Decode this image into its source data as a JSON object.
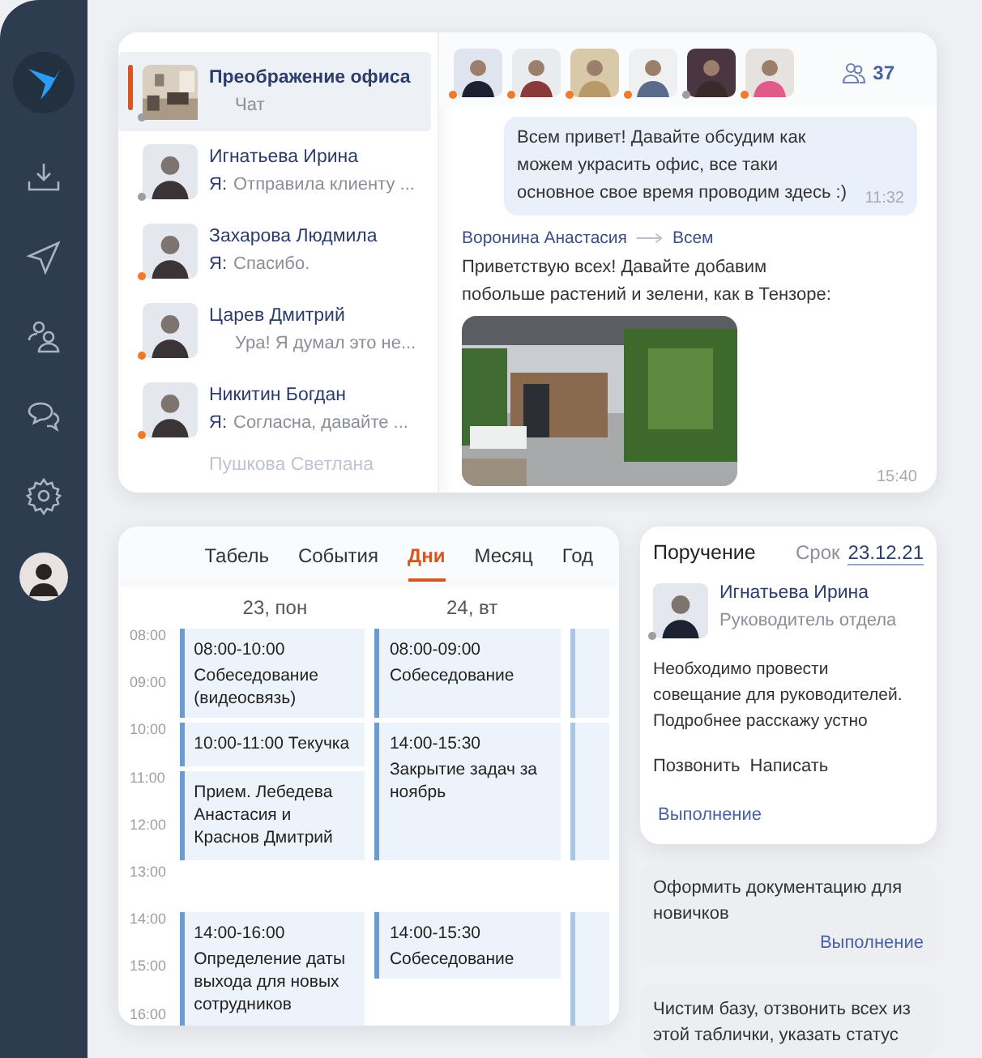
{
  "chats": [
    {
      "name": "Преображение офиса",
      "preview": "Чат",
      "kind": "group",
      "selected": true,
      "color": "#9e9e9e"
    },
    {
      "name": "Игнатьева Ирина",
      "preview": "Отправила клиенту ...",
      "prefix": "Я:",
      "kind": "person",
      "selected": false,
      "color": "#9e9e9e"
    },
    {
      "name": "Захарова Людмила",
      "preview": "Спасибо.",
      "prefix": "Я:",
      "kind": "person",
      "selected": false,
      "color": "#f07a2a"
    },
    {
      "name": "Царев Дмитрий",
      "preview": "Ура! Я думал это не...",
      "kind": "person",
      "selected": false,
      "color": "#f07a2a"
    },
    {
      "name": "Никитин Богдан",
      "preview": "Согласна, давайте ...",
      "prefix": "Я:",
      "kind": "person",
      "selected": false,
      "color": "#f07a2a"
    },
    {
      "name": "Пушкова Светлана",
      "kind": "faded"
    }
  ],
  "participants": [
    {
      "color": "#f07a2a"
    },
    {
      "color": "#f07a2a"
    },
    {
      "color": "#f07a2a"
    },
    {
      "color": "#f07a2a"
    },
    {
      "color": "#9e9e9e"
    },
    {
      "color": "#f07a2a"
    }
  ],
  "participant_count": "37",
  "messages": [
    {
      "kind": "own",
      "text": "Всем привет! Давайте обсудим как можем украсить офис, все таки основное свое время проводим здесь :)",
      "time": "11:32"
    },
    {
      "kind": "incoming",
      "author": "Воронина Анастасия",
      "recipient": "Всем",
      "text": "Приветствую всех! Давайте добавим побольше растений и зелени, как в Тензоре:",
      "time": "15:40"
    }
  ],
  "calendar": {
    "tabs": [
      {
        "label": "Табель",
        "selected": false
      },
      {
        "label": "События",
        "selected": false
      },
      {
        "label": "Дни",
        "selected": true
      },
      {
        "label": "Месяц",
        "selected": false
      },
      {
        "label": "Год",
        "selected": false
      }
    ],
    "days": [
      {
        "label": "23, пон",
        "events": [
          {
            "time": "08:00-10:00",
            "title": "Собеседование (видеосвязь)"
          },
          {
            "time": "10:00-11:00 Текучка"
          },
          {
            "title": "Прием. Лебедева Анастасия и Краснов Дмитрий"
          },
          {
            "time": "14:00-16:00",
            "title": "Определение даты выхода для новых сотрудников"
          }
        ]
      },
      {
        "label": "24, вт",
        "events": [
          {
            "time": "08:00-09:00",
            "title": "Собеседование"
          },
          {
            "time": "14:00-15:30",
            "title": "Закрытие задач за ноябрь"
          },
          {
            "time": "14:00-15:30",
            "title": "Собеседование"
          }
        ]
      },
      {
        "events": [
          {
            "kind": "cut"
          },
          {
            "kind": "cut"
          },
          {
            "kind": "cut"
          }
        ]
      }
    ],
    "hours": [
      "08:00",
      "09:00",
      "10:00",
      "11:00",
      "12:00",
      "13:00",
      "14:00",
      "15:00",
      "16:00"
    ]
  },
  "task": {
    "title": "Поручение",
    "due_label": "Срок",
    "due": "23.12.21",
    "person": {
      "name": "Игнатьева Ирина",
      "role": "Руководитель отдела",
      "color": "#9e9e9e"
    },
    "text": "Необходимо провести совещание для руководителей. Подробнее расскажу устно",
    "actions": [
      "Позвонить",
      "Написать"
    ],
    "link": "Выполнение"
  },
  "tasks": [
    {
      "text": "Оформить документацию для новичков",
      "link": "Выполнение"
    },
    {
      "text": "Чистим базу, отзвонить всех из этой таблички, указать статус"
    }
  ]
}
